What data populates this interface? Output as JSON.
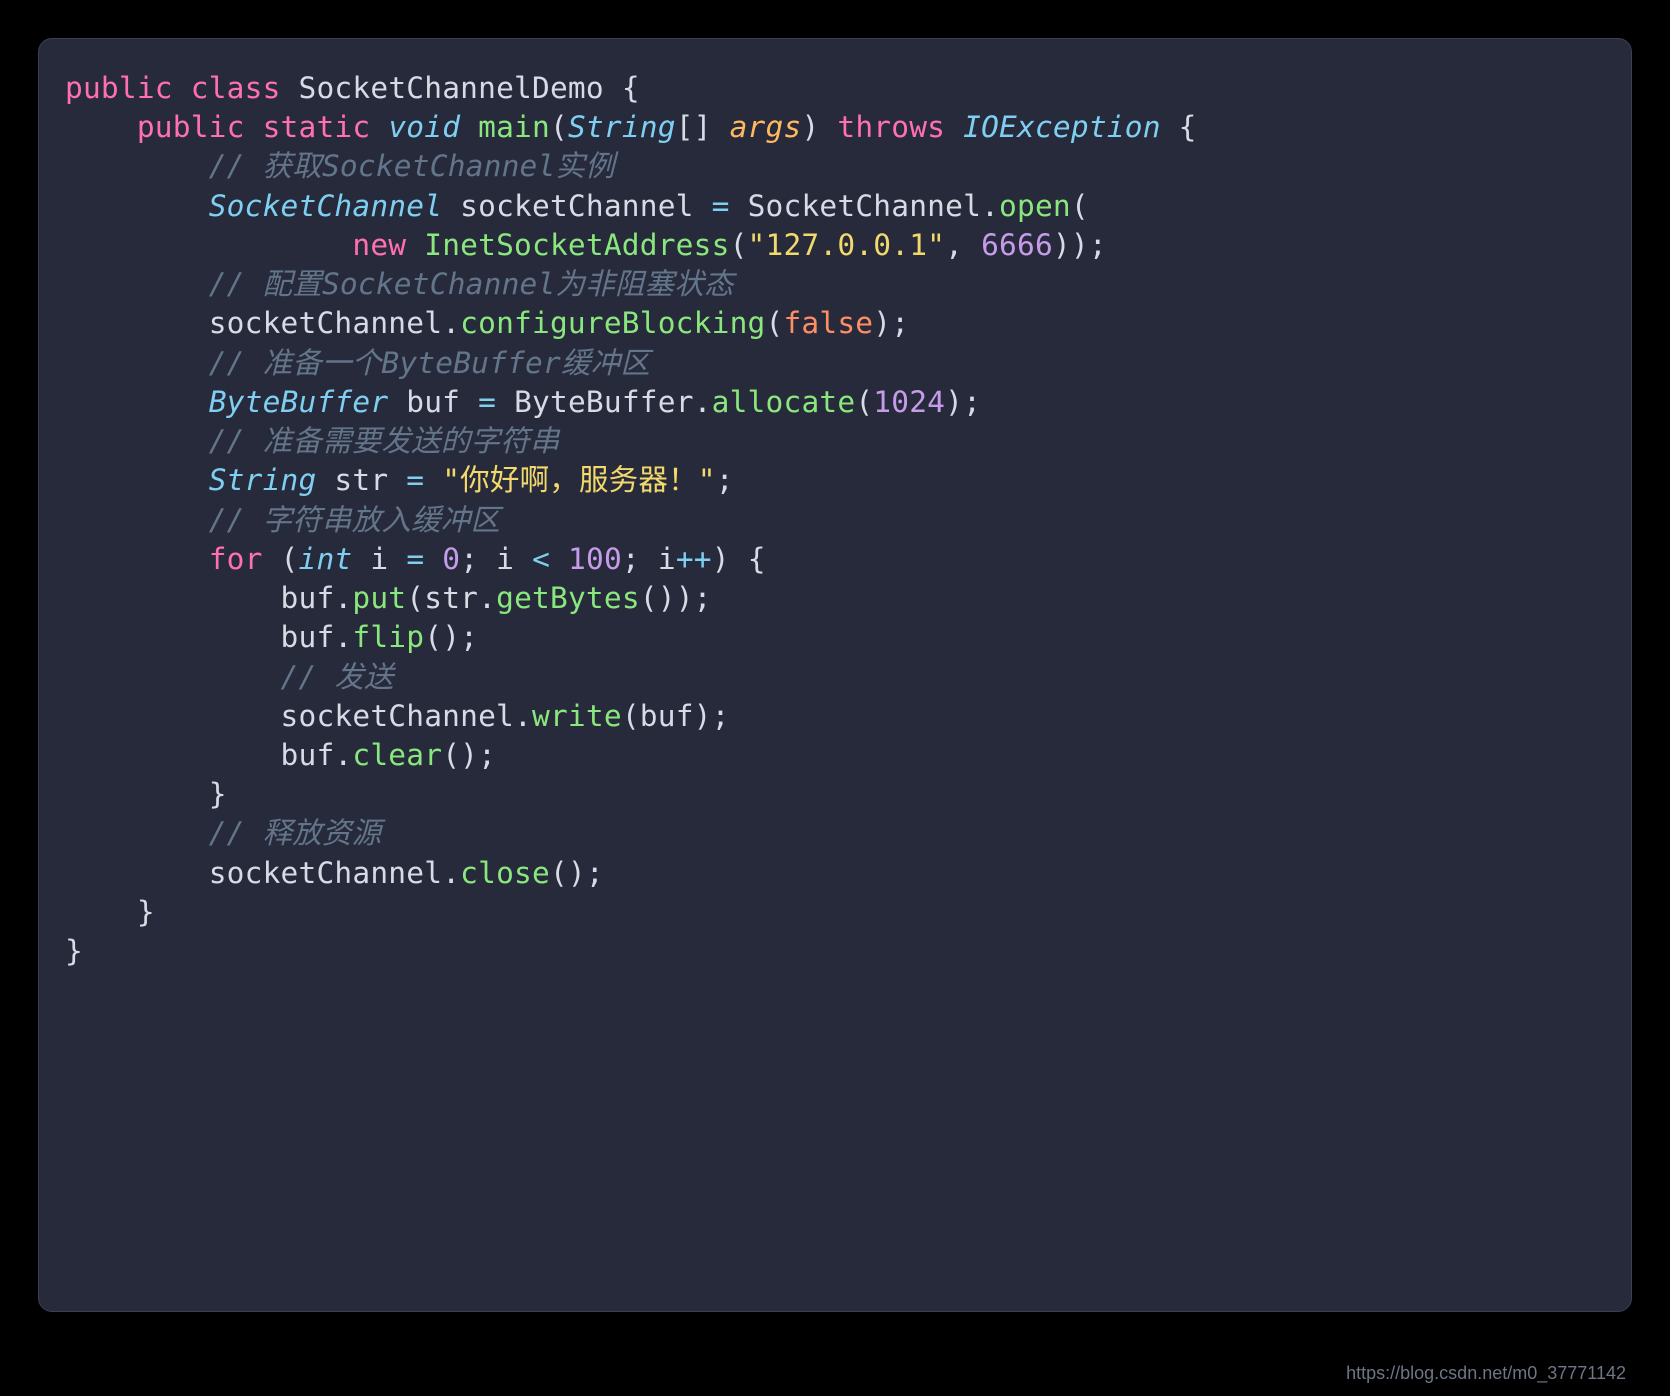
{
  "watermark": "https://blog.csdn.net/m0_37771142",
  "code": {
    "l1": {
      "kw1": "public",
      "kw2": "class",
      "cls": "SocketChannelDemo",
      "ob": "{"
    },
    "l2": {
      "kw1": "public",
      "kw2": "static",
      "typ": "void",
      "fn": "main",
      "op": "(",
      "ptyp": "String",
      "arr": "[]",
      "arg": "args",
      "cp": ")",
      "kw3": "throws",
      "exc": "IOException",
      "ob": "{"
    },
    "l3": {
      "cmt": "// 获取SocketChannel实例"
    },
    "l4": {
      "typ": "SocketChannel",
      "var": "socketChannel",
      "eq": "=",
      "cls": "SocketChannel",
      "dot": ".",
      "fn": "open",
      "op": "("
    },
    "l5": {
      "kw": "new",
      "fn": "InetSocketAddress",
      "op": "(",
      "str": "\"127.0.0.1\"",
      "c": ",",
      "num": "6666",
      "cp": "));"
    },
    "l6": {
      "cmt": "// 配置SocketChannel为非阻塞状态"
    },
    "l7": {
      "var": "socketChannel",
      "dot": ".",
      "fn": "configureBlocking",
      "op": "(",
      "cst": "false",
      "cp": ");"
    },
    "l8": {
      "cmt": "// 准备一个ByteBuffer缓冲区"
    },
    "l9": {
      "typ": "ByteBuffer",
      "var": "buf",
      "eq": "=",
      "cls": "ByteBuffer",
      "dot": ".",
      "fn": "allocate",
      "op": "(",
      "num": "1024",
      "cp": ");"
    },
    "l10": {
      "cmt": "// 准备需要发送的字符串"
    },
    "l11": {
      "typ": "String",
      "var": "str",
      "eq": "=",
      "str": "\"你好啊，服务器！\"",
      "sc": ";"
    },
    "l12": {
      "cmt": "// 字符串放入缓冲区"
    },
    "l13": {
      "kw": "for",
      "op": "(",
      "typ": "int",
      "var": "i",
      "eq": "=",
      "n0": "0",
      "sc1": ";",
      "var2": "i",
      "lt": "<",
      "n1": "100",
      "sc2": ";",
      "var3": "i",
      "inc": "++",
      "cp": ")",
      "ob": "{"
    },
    "l14": {
      "var": "buf",
      "dot": ".",
      "fn": "put",
      "op": "(",
      "var2": "str",
      "dot2": ".",
      "fn2": "getBytes",
      "pp": "());"
    },
    "l15": {
      "var": "buf",
      "dot": ".",
      "fn": "flip",
      "pp": "();"
    },
    "l16": {
      "cmt": "// 发送"
    },
    "l17": {
      "var": "socketChannel",
      "dot": ".",
      "fn": "write",
      "op": "(",
      "arg": "buf",
      "cp": ");"
    },
    "l18": {
      "var": "buf",
      "dot": ".",
      "fn": "clear",
      "pp": "();"
    },
    "l19": {
      "cb": "}"
    },
    "l20": {
      "cmt": "// 释放资源"
    },
    "l21": {
      "var": "socketChannel",
      "dot": ".",
      "fn": "close",
      "pp": "();"
    },
    "l22": {
      "cb": "}"
    },
    "l23": {
      "cb": "}"
    }
  }
}
